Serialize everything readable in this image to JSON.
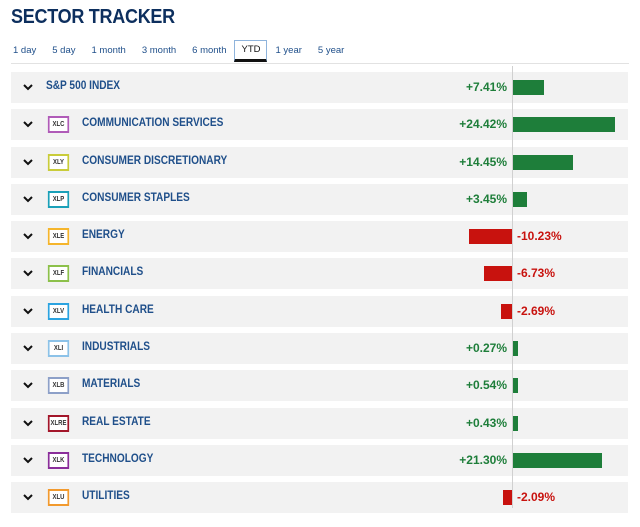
{
  "header": {
    "title": "SECTOR TRACKER"
  },
  "tabs": [
    {
      "label": "1 day",
      "active": false
    },
    {
      "label": "5 day",
      "active": false
    },
    {
      "label": "1 month",
      "active": false
    },
    {
      "label": "3 month",
      "active": false
    },
    {
      "label": "6 month",
      "active": false
    },
    {
      "label": "YTD",
      "active": true
    },
    {
      "label": "1 year",
      "active": false
    },
    {
      "label": "5 year",
      "active": false
    }
  ],
  "colors": {
    "positive": "#1e7e3a",
    "negative": "#c8120e",
    "name": "#1f4f8a"
  },
  "chart_data": {
    "type": "bar",
    "title": "SECTOR TRACKER",
    "period": "YTD",
    "unit": "%",
    "categories": [
      "S&P 500 INDEX",
      "COMMUNICATION SERVICES",
      "CONSUMER DISCRETIONARY",
      "CONSUMER STAPLES",
      "ENERGY",
      "FINANCIALS",
      "HEALTH CARE",
      "INDUSTRIALS",
      "MATERIALS",
      "REAL ESTATE",
      "TECHNOLOGY",
      "UTILITIES"
    ],
    "tickers": [
      "",
      "XLC",
      "XLY",
      "XLP",
      "XLE",
      "XLF",
      "XLV",
      "XLI",
      "XLB",
      "XLRE",
      "XLK",
      "XLU"
    ],
    "badge_colors": [
      "",
      "#b05bb8",
      "#c9cc3a",
      "#1aa0b8",
      "#f5b52c",
      "#8cc04a",
      "#2ba3e0",
      "#8cc2e8",
      "#8da0c8",
      "#a3162a",
      "#8a2e9a",
      "#f29a2e"
    ],
    "values": [
      7.41,
      24.42,
      14.45,
      3.45,
      -10.23,
      -6.73,
      -2.69,
      0.27,
      0.54,
      0.43,
      21.3,
      -2.09
    ],
    "labels": [
      "+7.41%",
      "+24.42%",
      "+14.45%",
      "+3.45%",
      "-10.23%",
      "-6.73%",
      "-2.69%",
      "+0.27%",
      "+0.54%",
      "+0.43%",
      "+21.30%",
      "-2.09%"
    ]
  }
}
